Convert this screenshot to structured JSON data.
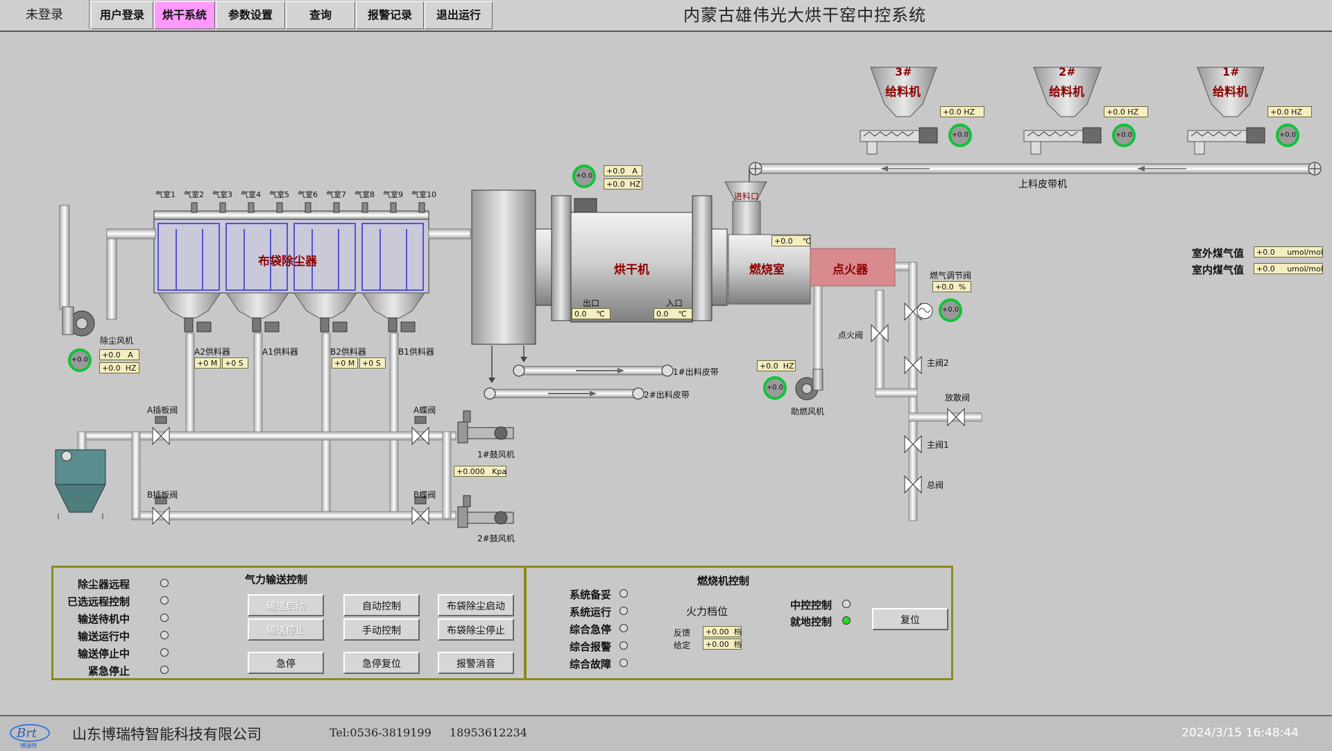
{
  "topbar": {
    "login_status": "未登录",
    "menu": [
      {
        "label": "用户登录",
        "active": false
      },
      {
        "label": "烘干系统",
        "active": true
      },
      {
        "label": "参数设置",
        "active": false
      },
      {
        "label": "查询",
        "active": false
      },
      {
        "label": "报警记录",
        "active": false
      },
      {
        "label": "退出运行",
        "active": false
      }
    ],
    "title": "内蒙古雄伟光大烘干窑中控系统"
  },
  "colors": {
    "active_menu": "#ff99ff",
    "indicator_ring": "#11c23a",
    "panel_border": "#8a8a20",
    "igniter": "#d98a8e"
  },
  "feeders": [
    {
      "num": "3#",
      "name": "给料机",
      "freq": "+0.0",
      "unit": "HZ",
      "ind": "+0.0"
    },
    {
      "num": "2#",
      "name": "给料机",
      "freq": "+0.0",
      "unit": "HZ",
      "ind": "+0.0"
    },
    {
      "num": "1#",
      "name": "给料机",
      "freq": "+0.0",
      "unit": "HZ",
      "ind": "+0.0"
    }
  ],
  "belt_upper": "上料皮带机",
  "gas": {
    "outdoor_label": "室外煤气值",
    "outdoor_val": "+0.0",
    "indoor_label": "室内煤气值",
    "indoor_val": "+0.0",
    "unit": "umol/mol"
  },
  "dryer": {
    "label": "烘干机",
    "motor_a": "+0.0",
    "motor_hz": "+0.0",
    "motor_ind": "+0.0",
    "unit_a": "A",
    "unit_hz": "HZ",
    "outlet_label": "出口",
    "outlet_val": "0.0",
    "inlet_label": "入口",
    "inlet_val": "0.0",
    "temp_unit": "℃"
  },
  "combustion": {
    "label": "燃烧室",
    "temp": "+0.0",
    "temp_unit": "℃",
    "feed_inlet": "进料口",
    "igniter": "点火器",
    "gas_valve_label": "燃气调节阀",
    "gas_valve_val": "+0.0",
    "gas_valve_unit": "%",
    "gas_valve_ind": "+0.0",
    "ignite_valve": "点火阀",
    "main_valve2": "主阀2",
    "vent_valve": "放散阀",
    "main_valve1": "主阀1",
    "total_valve": "总阀",
    "fan_label": "助燃风机",
    "fan_hz": "+0.0",
    "fan_ind": "+0.0"
  },
  "dust": {
    "label": "布袋除尘器",
    "chambers": [
      "气室1",
      "气室2",
      "气室3",
      "气室4",
      "气室5",
      "气室6",
      "气室7",
      "气室8",
      "气室9",
      "气室10"
    ],
    "fan_label": "除尘风机",
    "fan_a": "+0.0",
    "fan_hz": "+0.0",
    "fan_ind": "+0.0",
    "feeders": [
      "A2供料器",
      "A1供料器",
      "B2供料器",
      "B1供料器"
    ],
    "a_m": "+0",
    "a_s": "+0",
    "b_m": "+0",
    "b_s": "+0",
    "unit_m": "M",
    "unit_s": "S"
  },
  "belts": {
    "out1": "1#出料皮带",
    "out2": "2#出料皮带"
  },
  "pneumatic": {
    "a_gate": "A插板阀",
    "a_butterfly": "A蝶阀",
    "b_gate": "B插板阀",
    "b_butterfly": "B蝶阀",
    "blower1": "1#鼓风机",
    "blower2": "2#鼓风机",
    "pressure": "+0.000",
    "pressure_unit": "Kpa"
  },
  "panel_left": {
    "title": "气力输送控制",
    "statuses": [
      "除尘器远程",
      "已选远程控制",
      "输送待机中",
      "输送运行中",
      "输送停止中",
      "紧急停止"
    ],
    "buttons": [
      {
        "label": "输送启动",
        "disabled": true
      },
      {
        "label": "自动控制",
        "disabled": false
      },
      {
        "label": "布袋除尘启动",
        "disabled": false
      },
      {
        "label": "输送停止",
        "disabled": true
      },
      {
        "label": "手动控制",
        "disabled": false
      },
      {
        "label": "布袋除尘停止",
        "disabled": false
      },
      {
        "label": "急停",
        "disabled": false
      },
      {
        "label": "急停复位",
        "disabled": false
      },
      {
        "label": "报警消音",
        "disabled": false
      }
    ]
  },
  "panel_right": {
    "title": "燃烧机控制",
    "statuses": [
      "系统备妥",
      "系统运行",
      "综合急停",
      "综合报警",
      "综合故障"
    ],
    "fire_label": "火力档位",
    "feedback_label": "反馈",
    "feedback_val": "+0.00",
    "set_label": "给定",
    "set_val": "+0.00",
    "unit": "档",
    "central_label": "中控控制",
    "local_label": "就地控制",
    "reset_label": "复位"
  },
  "footer": {
    "company": "山东博瑞特智能科技有限公司",
    "tel": "Tel:0536-3819199",
    "mobile": "18953612234",
    "datetime": "2024/3/15 16:48:44",
    "logo_text": "Brt",
    "logo_sub": "博瑞特"
  }
}
